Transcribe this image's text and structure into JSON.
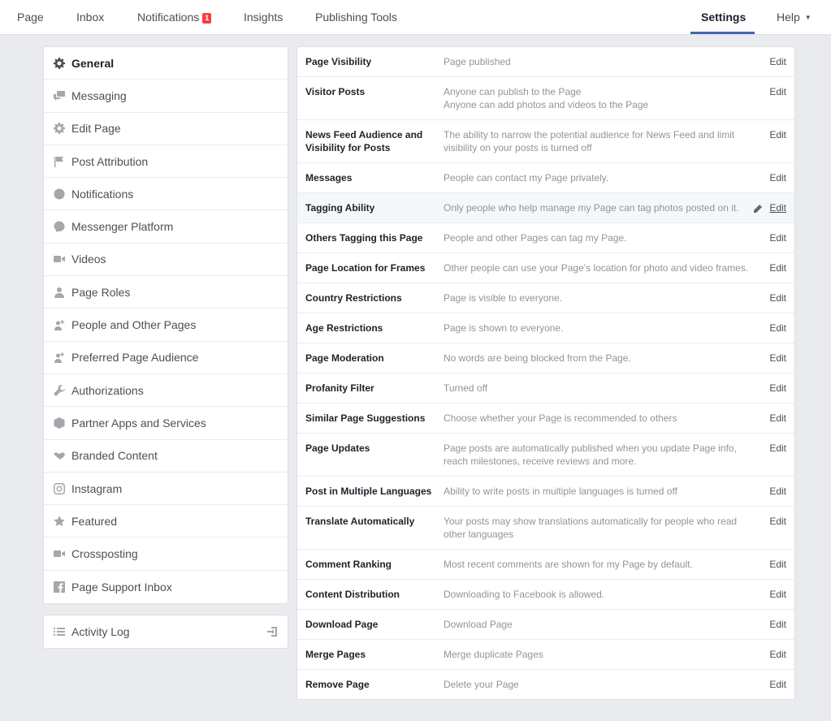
{
  "topnav": {
    "items": [
      {
        "label": "Page"
      },
      {
        "label": "Inbox"
      },
      {
        "label": "Notifications",
        "badge": "1"
      },
      {
        "label": "Insights"
      },
      {
        "label": "Publishing Tools"
      },
      {
        "label": "Settings"
      },
      {
        "label": "Help"
      }
    ],
    "accent": "#4267b2",
    "badge_color": "#fa3e3e"
  },
  "sidebar": {
    "items": [
      {
        "label": "General",
        "icon": "gear-icon"
      },
      {
        "label": "Messaging",
        "icon": "chat-bubbles-icon"
      },
      {
        "label": "Edit Page",
        "icon": "gear-icon"
      },
      {
        "label": "Post Attribution",
        "icon": "flag-icon"
      },
      {
        "label": "Notifications",
        "icon": "globe-icon"
      },
      {
        "label": "Messenger Platform",
        "icon": "messenger-icon"
      },
      {
        "label": "Videos",
        "icon": "video-camera-icon"
      },
      {
        "label": "Page Roles",
        "icon": "person-icon"
      },
      {
        "label": "People and Other Pages",
        "icon": "add-person-icon"
      },
      {
        "label": "Preferred Page Audience",
        "icon": "add-person-icon"
      },
      {
        "label": "Authorizations",
        "icon": "wrench-icon"
      },
      {
        "label": "Partner Apps and Services",
        "icon": "cube-icon"
      },
      {
        "label": "Branded Content",
        "icon": "handshake-icon"
      },
      {
        "label": "Instagram",
        "icon": "instagram-icon"
      },
      {
        "label": "Featured",
        "icon": "star-icon"
      },
      {
        "label": "Crossposting",
        "icon": "video-camera-icon"
      },
      {
        "label": "Page Support Inbox",
        "icon": "facebook-icon"
      }
    ],
    "activity_log": {
      "label": "Activity Log",
      "icon": "list-icon",
      "exit_icon": "export-icon"
    }
  },
  "settings": {
    "edit_label": "Edit",
    "rows": [
      {
        "name": "Page Visibility",
        "desc": [
          "Page published"
        ]
      },
      {
        "name": "Visitor Posts",
        "desc": [
          "Anyone can publish to the Page",
          "Anyone can add photos and videos to the Page"
        ]
      },
      {
        "name": "News Feed Audience and Visibility for Posts",
        "desc": [
          "The ability to narrow the potential audience for News Feed and limit visibility on your posts is turned off"
        ]
      },
      {
        "name": "Messages",
        "desc": [
          "People can contact my Page privately."
        ]
      },
      {
        "name": "Tagging Ability",
        "desc": [
          "Only people who help manage my Page can tag photos posted on it."
        ],
        "hover": true
      },
      {
        "name": "Others Tagging this Page",
        "desc": [
          "People and other Pages can tag my Page."
        ]
      },
      {
        "name": "Page Location for Frames",
        "desc": [
          "Other people can use your Page's location for photo and video frames."
        ]
      },
      {
        "name": "Country Restrictions",
        "desc": [
          "Page is visible to everyone."
        ]
      },
      {
        "name": "Age Restrictions",
        "desc": [
          "Page is shown to everyone."
        ]
      },
      {
        "name": "Page Moderation",
        "desc": [
          "No words are being blocked from the Page."
        ]
      },
      {
        "name": "Profanity Filter",
        "desc": [
          "Turned off"
        ]
      },
      {
        "name": "Similar Page Suggestions",
        "desc": [
          "Choose whether your Page is recommended to others"
        ]
      },
      {
        "name": "Page Updates",
        "desc": [
          "Page posts are automatically published when you update Page info, reach milestones, receive reviews and more."
        ]
      },
      {
        "name": "Post in Multiple Languages",
        "desc": [
          "Ability to write posts in multiple languages is turned off"
        ]
      },
      {
        "name": "Translate Automatically",
        "desc": [
          "Your posts may show translations automatically for people who read other languages"
        ]
      },
      {
        "name": "Comment Ranking",
        "desc": [
          "Most recent comments are shown for my Page by default."
        ]
      },
      {
        "name": "Content Distribution",
        "desc": [
          "Downloading to Facebook is allowed."
        ]
      },
      {
        "name": "Download Page",
        "desc": [
          "Download Page"
        ]
      },
      {
        "name": "Merge Pages",
        "desc": [
          "Merge duplicate Pages"
        ]
      },
      {
        "name": "Remove Page",
        "desc": [
          "Delete your Page"
        ]
      }
    ]
  }
}
